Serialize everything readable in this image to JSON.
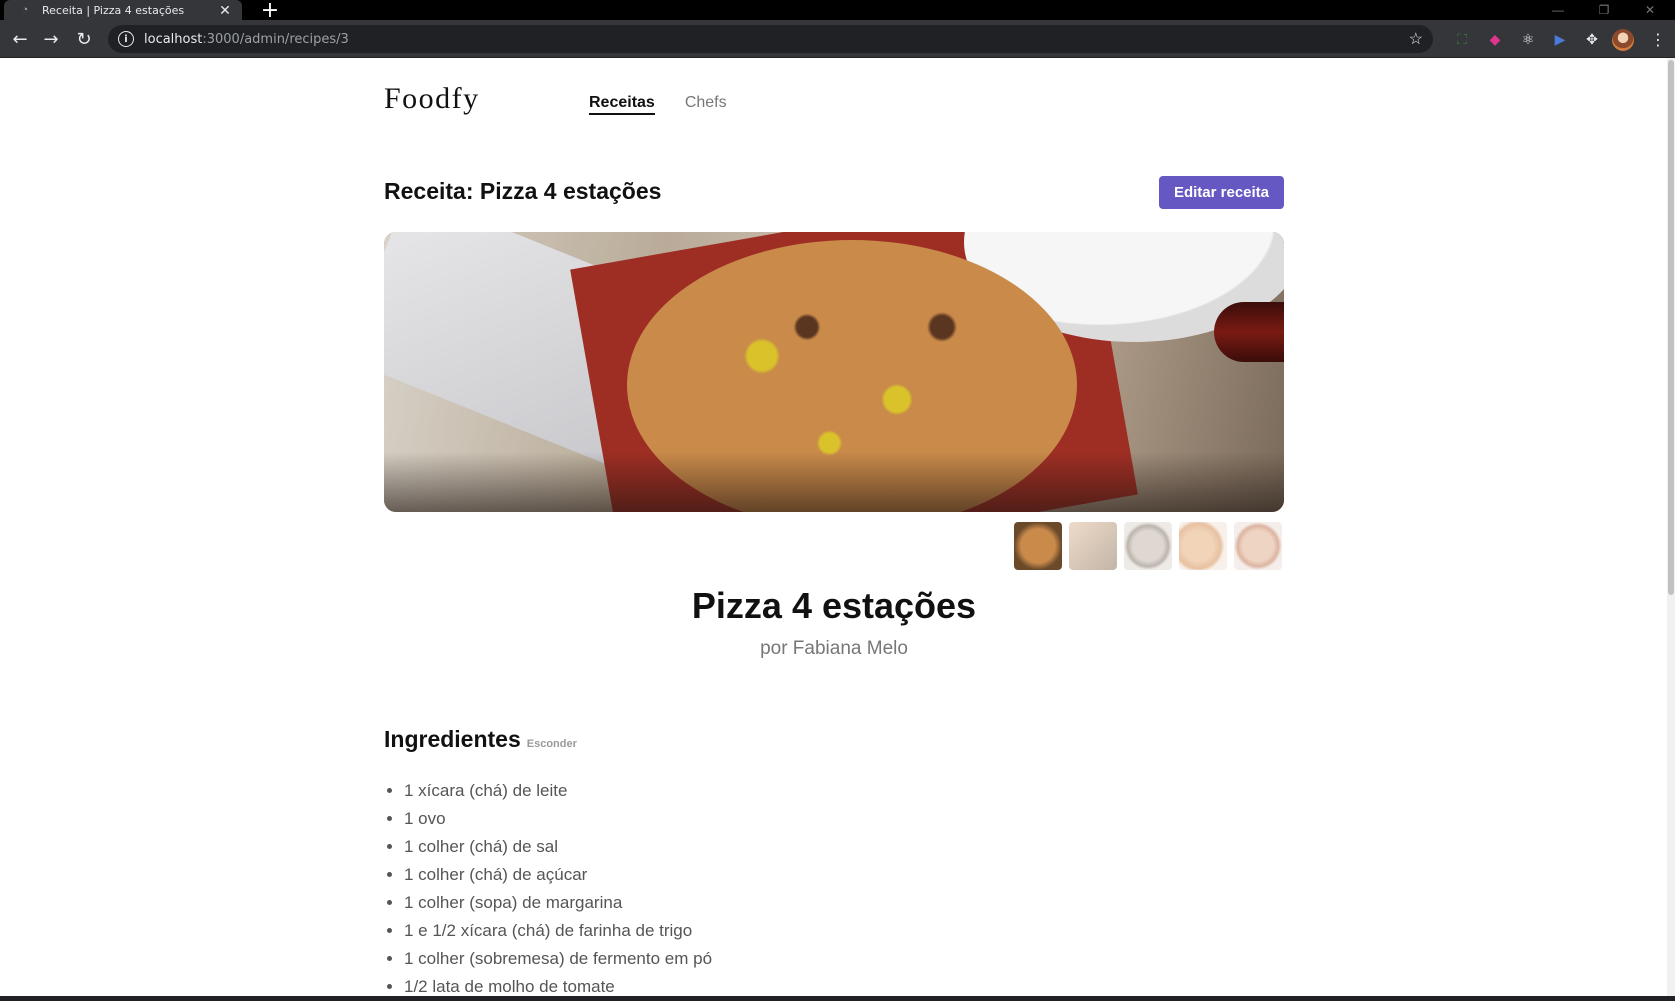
{
  "browser": {
    "tab_title": "Receita | Pizza 4 estações",
    "new_tab_symbol": "+",
    "url_host": "localhost",
    "url_path": ":3000/admin/recipes/3"
  },
  "site": {
    "logo": "Foodfy",
    "nav": [
      {
        "label": "Receitas",
        "active": true
      },
      {
        "label": "Chefs",
        "active": false
      }
    ]
  },
  "header": {
    "title": "Receita: Pizza 4 estações",
    "edit_button": "Editar receita"
  },
  "recipe": {
    "title": "Pizza 4 estações",
    "author": "por Fabiana Melo",
    "gallery": {
      "count": 5,
      "active_index": 0
    }
  },
  "ingredients_section": {
    "title": "Ingredientes",
    "toggle": "Esconder",
    "items": [
      "1 xícara (chá) de leite",
      "1 ovo",
      "1 colher (chá) de sal",
      "1 colher (chá) de açúcar",
      "1 colher (sopa) de margarina",
      "1 e 1/2 xícara (chá) de farinha de trigo",
      "1 colher (sobremesa) de fermento em pó",
      "1/2 lata de molho de tomate"
    ]
  },
  "colors": {
    "accent": "#6558c3",
    "text": "#111111",
    "muted": "#777777"
  }
}
